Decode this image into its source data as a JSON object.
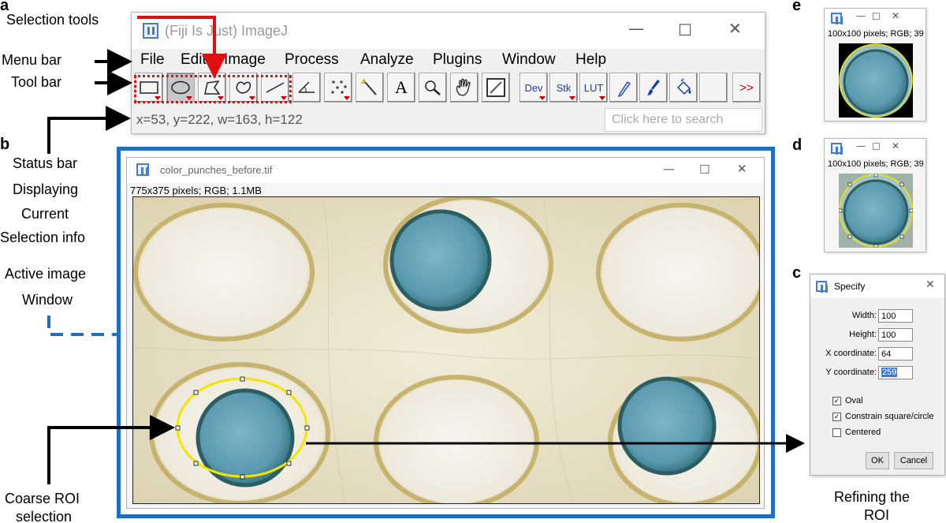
{
  "panel_letters": {
    "a": "a",
    "b": "b",
    "c": "c",
    "d": "d",
    "e": "e"
  },
  "annotations": {
    "selection_tools": "Selection tools",
    "menu_bar": "Menu bar",
    "tool_bar": "Tool bar",
    "status_bar_lines": [
      "Status bar",
      "Displaying",
      "Current",
      "Selection info"
    ],
    "active_image_lines": [
      "Active image",
      "Window"
    ],
    "coarse_roi_lines": [
      "Coarse ROI",
      "selection"
    ],
    "refining_lines": [
      "Refining the",
      "ROI"
    ]
  },
  "imagej": {
    "title": "(Fiji Is Just) ImageJ",
    "menu": [
      "File",
      "Edit",
      "Image",
      "Process",
      "Analyze",
      "Plugins",
      "Window",
      "Help"
    ],
    "tools": {
      "text_tool": "A",
      "dev": "Dev",
      "stk": "Stk",
      "lut": "LUT",
      "more": ">>"
    },
    "status": "x=53, y=222, w=163, h=122",
    "search_placeholder": "Click here to search"
  },
  "image_window": {
    "title": "color_punches_before.tif",
    "info": "775x375 pixels; RGB; 1.1MB"
  },
  "thumb_e": {
    "info": "100x100 pixels; RGB; 39"
  },
  "thumb_d": {
    "info": "100x100 pixels; RGB; 39"
  },
  "specify": {
    "title": "Specify",
    "width_label": "Width:",
    "width_value": "100",
    "height_label": "Height:",
    "height_value": "100",
    "x_label": "X coordinate:",
    "x_value": "64",
    "y_label": "Y coordinate:",
    "y_value": "259",
    "oval_label": "Oval",
    "oval_checked": true,
    "constrain_label": "Constrain square/circle",
    "constrain_checked": true,
    "centered_label": "Centered",
    "centered_checked": false,
    "ok": "OK",
    "cancel": "Cancel"
  },
  "colors": {
    "blue_frame": "#1f6fc0",
    "red_highlight": "#e01010",
    "roi_yellow": "#f2e600",
    "punch_blue": "#5b9ab0"
  }
}
